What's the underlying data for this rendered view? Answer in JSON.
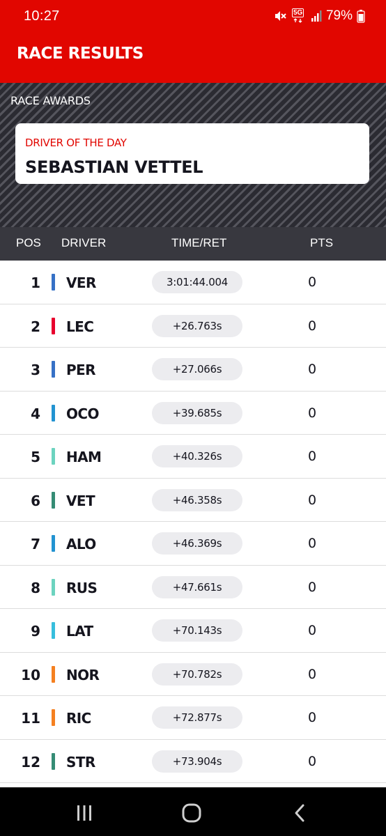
{
  "status_bar": {
    "time": "10:27",
    "network_label": "5G",
    "battery_text": "79%",
    "icons": [
      "mute-icon",
      "network-5g-icon",
      "signal-icon",
      "battery-icon"
    ]
  },
  "header": {
    "title": "RACE RESULTS",
    "background_color": "#e10600"
  },
  "awards": {
    "section_title": "RACE AWARDS",
    "card_label": "DRIVER OF THE DAY",
    "card_value": "SEBASTIAN VETTEL"
  },
  "table": {
    "columns": {
      "pos": "POS",
      "driver": "DRIVER",
      "time": "TIME/RET",
      "pts": "PTS"
    },
    "rows": [
      {
        "pos": "1",
        "driver": "VER",
        "time": "3:01:44.004",
        "pts": "0",
        "team_color": "#3671c6"
      },
      {
        "pos": "2",
        "driver": "LEC",
        "time": "+26.763s",
        "pts": "0",
        "team_color": "#e8002d"
      },
      {
        "pos": "3",
        "driver": "PER",
        "time": "+27.066s",
        "pts": "0",
        "team_color": "#3671c6"
      },
      {
        "pos": "4",
        "driver": "OCO",
        "time": "+39.685s",
        "pts": "0",
        "team_color": "#2293d1"
      },
      {
        "pos": "5",
        "driver": "HAM",
        "time": "+40.326s",
        "pts": "0",
        "team_color": "#6cd3bf"
      },
      {
        "pos": "6",
        "driver": "VET",
        "time": "+46.358s",
        "pts": "0",
        "team_color": "#358c75"
      },
      {
        "pos": "7",
        "driver": "ALO",
        "time": "+46.369s",
        "pts": "0",
        "team_color": "#2293d1"
      },
      {
        "pos": "8",
        "driver": "RUS",
        "time": "+47.661s",
        "pts": "0",
        "team_color": "#6cd3bf"
      },
      {
        "pos": "9",
        "driver": "LAT",
        "time": "+70.143s",
        "pts": "0",
        "team_color": "#37bedd"
      },
      {
        "pos": "10",
        "driver": "NOR",
        "time": "+70.782s",
        "pts": "0",
        "team_color": "#f58020"
      },
      {
        "pos": "11",
        "driver": "RIC",
        "time": "+72.877s",
        "pts": "0",
        "team_color": "#f58020"
      },
      {
        "pos": "12",
        "driver": "STR",
        "time": "+73.904s",
        "pts": "0",
        "team_color": "#358c75"
      }
    ]
  },
  "nav_bar": {
    "icons": [
      "recent-apps-icon",
      "home-icon",
      "back-icon"
    ]
  }
}
